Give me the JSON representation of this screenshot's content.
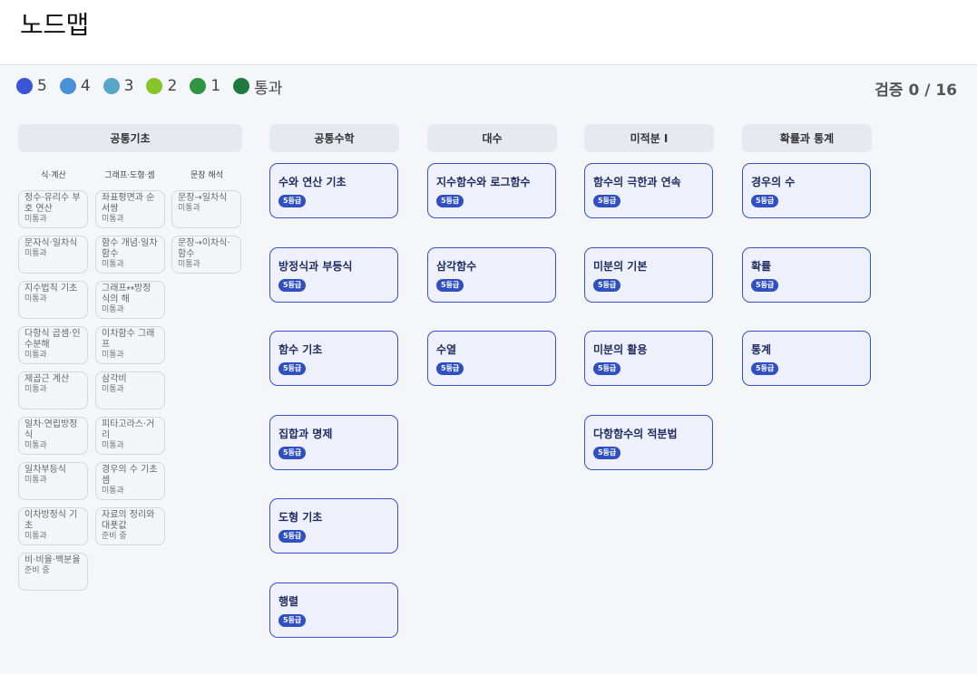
{
  "page": {
    "title": "노드맵"
  },
  "legend": [
    {
      "label": "5",
      "color": "#3a56d4"
    },
    {
      "label": "4",
      "color": "#4a90d9"
    },
    {
      "label": "3",
      "color": "#5aa6c8"
    },
    {
      "label": "2",
      "color": "#84c52a"
    },
    {
      "label": "1",
      "color": "#2e9540"
    },
    {
      "label": "통과",
      "color": "#1d7a3a"
    }
  ],
  "verify": {
    "text": "검증 0 / 16"
  },
  "foundation": {
    "title": "공통기초",
    "columns": [
      {
        "title": "식·계산",
        "items": [
          {
            "title": "정수·유리수 부호 연산",
            "status": "미통과"
          },
          {
            "title": "문자식·일차식",
            "status": "미통과"
          },
          {
            "title": "지수법칙 기초",
            "status": "미통과"
          },
          {
            "title": "다항식 곱셈·인수분해",
            "status": "미통과"
          },
          {
            "title": "제곱근 계산",
            "status": "미통과"
          },
          {
            "title": "일차·연립방정식",
            "status": "미통과"
          },
          {
            "title": "일차부등식",
            "status": "미통과"
          },
          {
            "title": "이차방정식 기초",
            "status": "미통과"
          },
          {
            "title": "비·비율·백분율",
            "status": "준비 중"
          }
        ]
      },
      {
        "title": "그래프·도형·셈",
        "items": [
          {
            "title": "좌표평면과 순서쌍",
            "status": "미통과"
          },
          {
            "title": "함수 개념·일차함수",
            "status": "미통과"
          },
          {
            "title": "그래프↔방정식의 해",
            "status": "미통과"
          },
          {
            "title": "이차함수 그래프",
            "status": "미통과"
          },
          {
            "title": "삼각비",
            "status": "미통과"
          },
          {
            "title": "피타고라스·거리",
            "status": "미통과"
          },
          {
            "title": "경우의 수 기초 셈",
            "status": "미통과"
          },
          {
            "title": "자료의 정리와 대푯값",
            "status": "준비 중"
          }
        ]
      },
      {
        "title": "문장 해석",
        "items": [
          {
            "title": "문장→일차식",
            "status": "미통과"
          },
          {
            "title": "문장→이차식·함수",
            "status": "미통과"
          }
        ]
      }
    ]
  },
  "subjects": [
    {
      "title": "공통수학",
      "nodes": [
        {
          "title": "수와 연산 기초",
          "badge": "5등급"
        },
        {
          "title": "방정식과 부등식",
          "badge": "5등급"
        },
        {
          "title": "함수 기초",
          "badge": "5등급"
        },
        {
          "title": "집합과 명제",
          "badge": "5등급"
        },
        {
          "title": "도형 기초",
          "badge": "5등급"
        },
        {
          "title": "행렬",
          "badge": "5등급"
        }
      ]
    },
    {
      "title": "대수",
      "nodes": [
        {
          "title": "지수함수와 로그함수",
          "badge": "5등급"
        },
        {
          "title": "삼각함수",
          "badge": "5등급"
        },
        {
          "title": "수열",
          "badge": "5등급"
        }
      ]
    },
    {
      "title": "미적분 I",
      "nodes": [
        {
          "title": "함수의 극한과 연속",
          "badge": "5등급"
        },
        {
          "title": "미분의 기본",
          "badge": "5등급"
        },
        {
          "title": "미분의 활용",
          "badge": "5등급"
        },
        {
          "title": "다항함수의 적분법",
          "badge": "5등급"
        }
      ]
    },
    {
      "title": "확률과 통계",
      "nodes": [
        {
          "title": "경우의 수",
          "badge": "5등급"
        },
        {
          "title": "확률",
          "badge": "5등급"
        },
        {
          "title": "통계",
          "badge": "5등급"
        }
      ]
    }
  ]
}
